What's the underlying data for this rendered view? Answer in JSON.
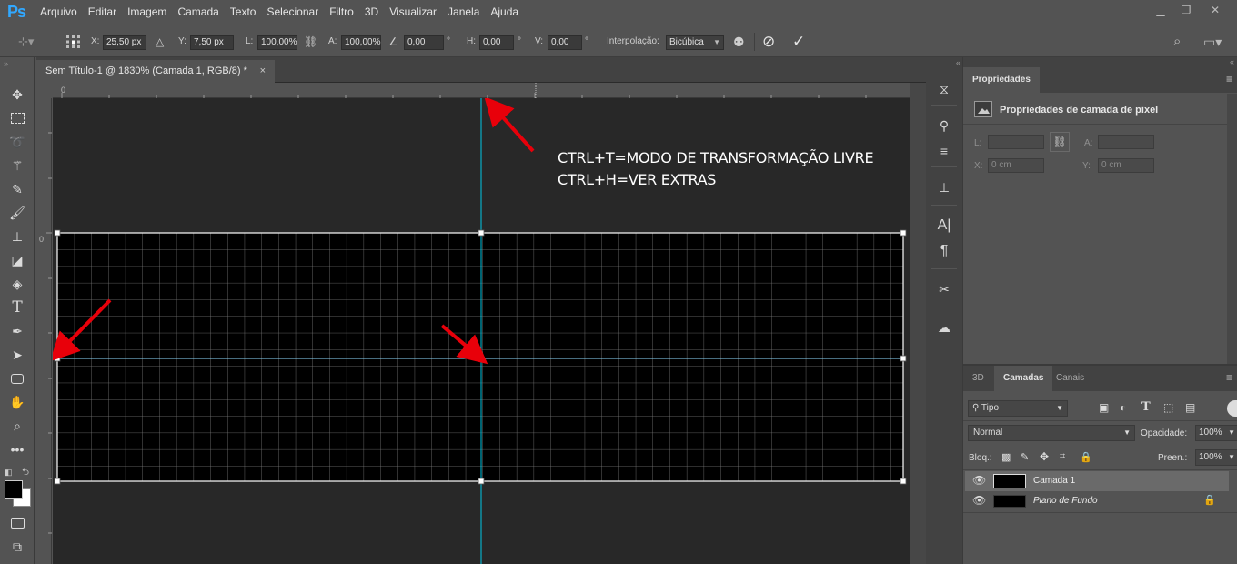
{
  "app": {
    "logo": "Ps"
  },
  "menu": [
    "Arquivo",
    "Editar",
    "Imagem",
    "Camada",
    "Texto",
    "Selecionar",
    "Filtro",
    "3D",
    "Visualizar",
    "Janela",
    "Ajuda"
  ],
  "window_controls": {
    "minimize": "▁",
    "restore": "❐",
    "close": "✕"
  },
  "options_bar": {
    "x_label": "X:",
    "x_value": "25,50 px",
    "y_label": "Y:",
    "y_value": "7,50 px",
    "w_label": "L:",
    "w_value": "100,00%",
    "h_label": "A:",
    "h_value": "100,00%",
    "rotate_value": "0,00",
    "rotate_unit": "°",
    "hskew_label": "H:",
    "hskew_value": "0,00",
    "hskew_unit": "°",
    "vskew_label": "V:",
    "vskew_value": "0,00",
    "vskew_unit": "°",
    "interp_label": "Interpolação:",
    "interp_value": "Bicúbica"
  },
  "document": {
    "tab_title": "Sem Título-1 @ 1830% (Camada 1, RGB/8) *",
    "tab_close": "×",
    "ruler_h_zero": "0",
    "ruler_v_zero": "0"
  },
  "annotation": {
    "line1": "CTRL+T=MODO DE TRANSFORMAÇÃO LIVRE",
    "line2": "CTRL+H=VER EXTRAS",
    "arrow_color": "#e8000a"
  },
  "properties_panel": {
    "tab": "Propriedades",
    "heading": "Propriedades de camada de pixel",
    "w_label": "L:",
    "h_label": "A:",
    "x_label": "X:",
    "x_value": "0 cm",
    "y_label": "Y:",
    "y_value": "0 cm"
  },
  "layers_panel": {
    "tabs": [
      "3D",
      "Camadas",
      "Canais"
    ],
    "filter_value": "Tipo",
    "blend_mode": "Normal",
    "opacity_label": "Opacidade:",
    "opacity_value": "100%",
    "lock_label": "Bloq.:",
    "fill_label": "Preen.:",
    "fill_value": "100%",
    "layers": [
      {
        "name": "Camada 1",
        "selected": true,
        "visible": true
      },
      {
        "name": "Plano de Fundo",
        "selected": false,
        "visible": true,
        "locked": true
      }
    ]
  },
  "colors": {
    "guide": "#00c8e6",
    "accent": "#31a8ff"
  }
}
